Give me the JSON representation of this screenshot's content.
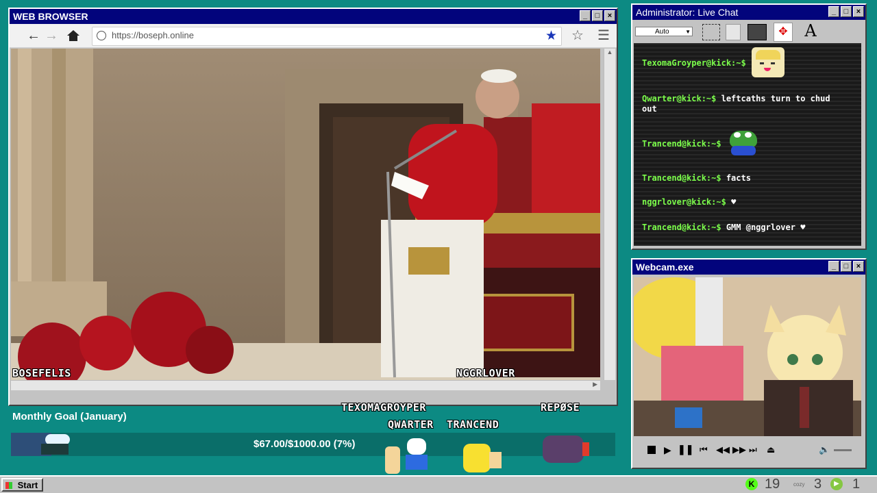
{
  "browser": {
    "title": "WEB BROWSER",
    "url": "https://boseph.online",
    "controls": [
      "_",
      "□",
      "×"
    ]
  },
  "stream_labels": {
    "left_name": "BOSEFELIS",
    "right_name": "NGGRLOVER"
  },
  "chat": {
    "title": "Administrator: Live Chat",
    "zoom_select": "Auto",
    "messages": [
      {
        "user": "TexomaGroyper@kick:~$",
        "text": "",
        "emote": "anime-emote"
      },
      {
        "user": "Qwarter@kick:~$",
        "text": "leftcaths turn to chud",
        "text2": "out"
      },
      {
        "user": "Trancend@kick:~$",
        "text": "",
        "emote": "pepe-emote"
      },
      {
        "user": "Trancend@kick:~$",
        "text": "facts"
      },
      {
        "user": "nggrlover@kick:~$",
        "text": "♥"
      },
      {
        "user": "Trancend@kick:~$",
        "text": "GMM @nggrlover ♥"
      }
    ]
  },
  "webcam": {
    "title": "Webcam.exe"
  },
  "goal": {
    "title": "Monthly Goal (January)",
    "amount_text": "$67.00/$1000.00 (7%)",
    "progress": 0.067
  },
  "supporters": {
    "a": "TEXOMAGROYPER",
    "b": "QWARTER",
    "c": "TRANCEND",
    "d": "REPØSE"
  },
  "taskbar": {
    "start_label": "Start",
    "count_a": "19",
    "count_b": "3",
    "count_c": "1",
    "cozy_label": "cozy"
  },
  "colors": {
    "desktop": "#0c8a83",
    "titlebar": "#02047c",
    "chat_user": "#7cff4b"
  }
}
